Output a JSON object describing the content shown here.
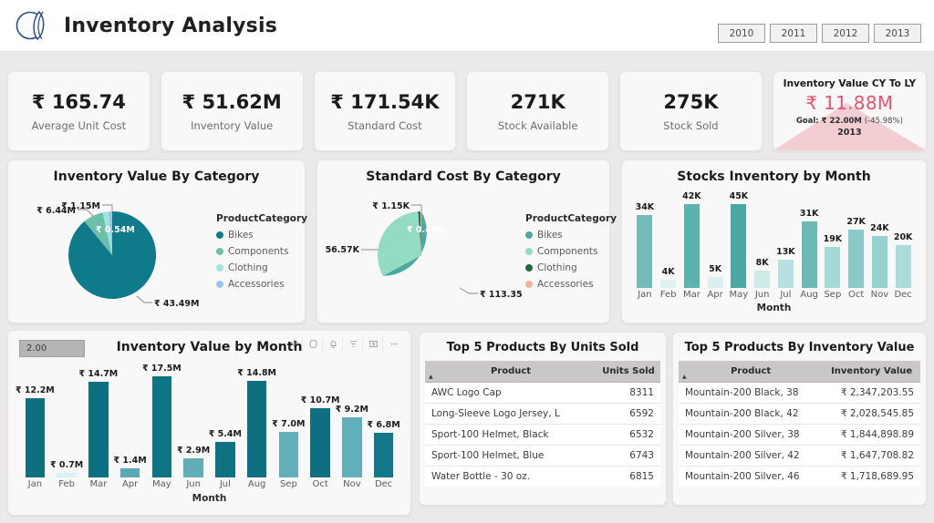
{
  "header": {
    "title": "Inventory Analysis",
    "logo_icon": "crescent-logo-icon",
    "year_slicer": [
      "2010",
      "2011",
      "2012",
      "2013"
    ]
  },
  "kpis": [
    {
      "value": "₹ 165.74",
      "label": "Average Unit Cost"
    },
    {
      "value": "₹ 51.62M",
      "label": "Inventory Value"
    },
    {
      "value": "₹ 171.54K",
      "label": "Standard Cost"
    },
    {
      "value": "271K",
      "label": "Stock Available"
    },
    {
      "value": "275K",
      "label": "Stock Sold"
    }
  ],
  "gauge": {
    "title": "Inventory Value CY To LY",
    "value": "₹ 11.88M",
    "goal_label": "Goal: ₹ 22.00M",
    "goal_pct": "(-45.98%)",
    "year": "2013",
    "value_color": "#e8536b",
    "area_color": "#f2cdd2"
  },
  "visual_tools": [
    {
      "name": "pin-icon"
    },
    {
      "name": "comment-icon"
    },
    {
      "name": "alert-icon"
    },
    {
      "name": "filter-icon"
    },
    {
      "name": "focus-mode-icon"
    },
    {
      "name": "more-options-icon"
    }
  ],
  "slicer": {
    "value": "2.00"
  },
  "legend_title": "ProductCategory",
  "tables": [
    {
      "title": "Top 5 Products By Units Sold",
      "columns": [
        "Product",
        "Units Sold"
      ],
      "rows": [
        [
          "AWC Logo Cap",
          "8311"
        ],
        [
          "Long-Sleeve Logo Jersey, L",
          "6592"
        ],
        [
          "Sport-100 Helmet, Black",
          "6532"
        ],
        [
          "Sport-100 Helmet, Blue",
          "6743"
        ],
        [
          "Water Bottle - 30 oz.",
          "6815"
        ]
      ]
    },
    {
      "title": "Top 5 Products By Inventory Value",
      "columns": [
        "Product",
        "Inventory Value"
      ],
      "rows": [
        [
          "Mountain-200 Black, 38",
          "₹ 2,347,203.55"
        ],
        [
          "Mountain-200 Black, 42",
          "₹ 2,028,545.85"
        ],
        [
          "Mountain-200 Silver, 38",
          "₹ 1,844,898.89"
        ],
        [
          "Mountain-200 Silver, 42",
          "₹ 1,647,708.82"
        ],
        [
          "Mountain-200 Silver, 46",
          "₹ 1,718,689.95"
        ]
      ]
    }
  ],
  "chart_data": [
    {
      "type": "pie",
      "title": "Inventory Value By Category",
      "legend_title": "ProductCategory",
      "legend_position": "right",
      "categories": [
        "Bikes",
        "Components",
        "Clothing",
        "Accessories"
      ],
      "values": [
        43.49,
        6.44,
        1.15,
        0.54
      ],
      "labels": [
        "₹ 43.49M",
        "₹ 6.44M",
        "₹ 1.15M",
        "₹ 0.54M"
      ],
      "colors": [
        "#0e7a8a",
        "#6ebfa8",
        "#9fe5dd",
        "#9bc3e8"
      ]
    },
    {
      "type": "pie",
      "title": "Standard Cost By Category",
      "legend_title": "ProductCategory",
      "legend_position": "right",
      "categories": [
        "Bikes",
        "Components",
        "Clothing",
        "Accessories"
      ],
      "values": [
        113.35,
        56.57,
        1.15,
        0.46
      ],
      "labels": [
        "₹ 113.35K",
        "₹ 56.57K",
        "₹ 1.15K",
        "₹ 0.46K"
      ],
      "colors": [
        "#4aa8a0",
        "#93dcc3",
        "#1d6b3a",
        "#f1b39c"
      ]
    },
    {
      "type": "bar",
      "title": "Stocks Inventory by Month",
      "xlabel": "Month",
      "ylabel": "",
      "categories": [
        "Jan",
        "Feb",
        "Mar",
        "Apr",
        "May",
        "Jun",
        "Jul",
        "Aug",
        "Sep",
        "Oct",
        "Nov",
        "Dec"
      ],
      "values": [
        34,
        4,
        42,
        5,
        45,
        8,
        13,
        31,
        19,
        27,
        24,
        20
      ],
      "labels": [
        "34K",
        "4K",
        "42K",
        "5K",
        "45K",
        "8K",
        "13K",
        "31K",
        "19K",
        "27K",
        "24K",
        "20K"
      ],
      "ylim": [
        0,
        45
      ],
      "grid": false,
      "colors": [
        "#74bcb8",
        "#dff3f2",
        "#5cb3ae",
        "#daf0ee",
        "#4aa8a4",
        "#cdeae8",
        "#b7e1df",
        "#6bb9b4",
        "#a3d9d6",
        "#89cbc8",
        "#95d2cf",
        "#aadcd9"
      ]
    },
    {
      "type": "bar",
      "title": "Inventory Value by Month",
      "xlabel": "Month",
      "ylabel": "",
      "categories": [
        "Jan",
        "Feb",
        "Mar",
        "Apr",
        "May",
        "Jun",
        "Jul",
        "Aug",
        "Sep",
        "Oct",
        "Nov",
        "Dec"
      ],
      "values": [
        12.2,
        0.7,
        14.7,
        1.4,
        17.5,
        2.9,
        5.4,
        14.8,
        7.0,
        10.7,
        9.2,
        6.8
      ],
      "labels": [
        "₹ 12.2M",
        "₹ 0.7M",
        "₹ 14.7M",
        "₹ 1.4M",
        "₹ 17.5M",
        "₹ 2.9M",
        "₹ 5.4M",
        "₹ 14.8M",
        "₹ 7.0M",
        "₹ 10.7M",
        "₹ 9.2M",
        "₹ 6.8M"
      ],
      "ylim": [
        0,
        17.5
      ],
      "grid": false,
      "colors": [
        "#0e6f80",
        "#d8f1f5",
        "#0e6f80",
        "#5aa8b4",
        "#0e7585",
        "#62aeb8",
        "#0f7283",
        "#0e6f80",
        "#63afb9",
        "#0e6f80",
        "#5fb0b9",
        "#147787"
      ]
    }
  ]
}
